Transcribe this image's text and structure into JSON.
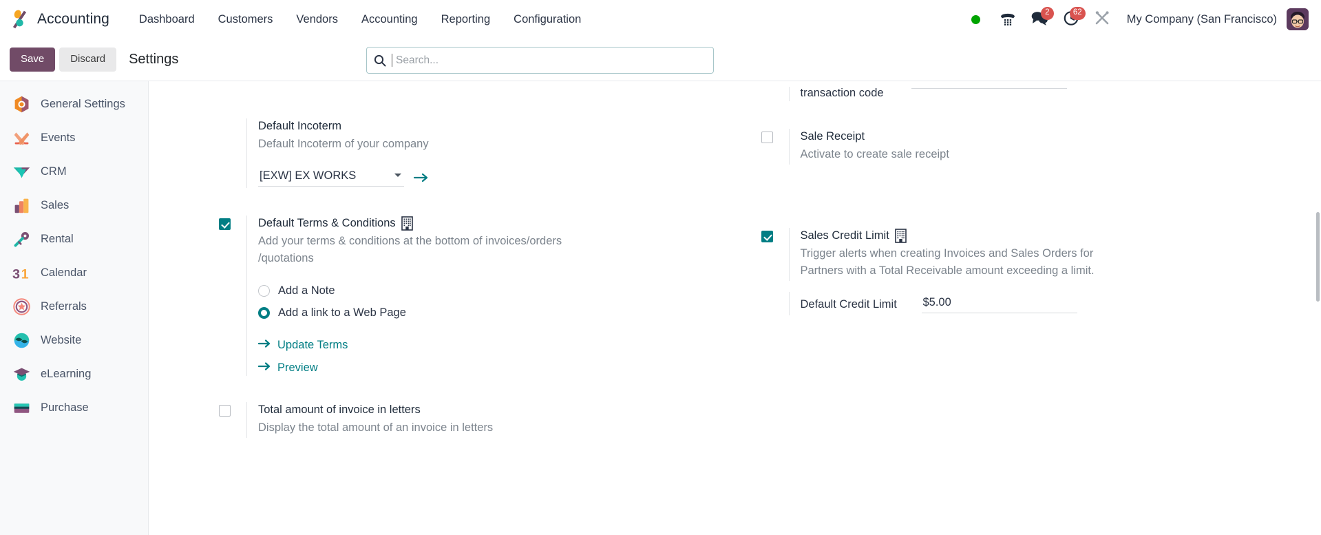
{
  "navbar": {
    "brand": "Accounting",
    "menu": [
      "Dashboard",
      "Customers",
      "Vendors",
      "Accounting",
      "Reporting",
      "Configuration"
    ],
    "status_indicator": "online",
    "messages_badge": "2",
    "activities_badge": "62",
    "company": "My Company (San Francisco)",
    "accent_color": "#714b67",
    "badge_color": "#d9534f",
    "status_color": "#00a400"
  },
  "control_panel": {
    "save_label": "Save",
    "discard_label": "Discard",
    "page_title": "Settings",
    "search_placeholder": "Search...",
    "search_value": ""
  },
  "sidebar": {
    "items": [
      {
        "label": "General Settings",
        "icon": "general-settings-icon"
      },
      {
        "label": "Events",
        "icon": "events-icon"
      },
      {
        "label": "CRM",
        "icon": "crm-icon"
      },
      {
        "label": "Sales",
        "icon": "sales-icon"
      },
      {
        "label": "Rental",
        "icon": "rental-icon"
      },
      {
        "label": "Calendar",
        "icon": "calendar-icon"
      },
      {
        "label": "Referrals",
        "icon": "referrals-icon"
      },
      {
        "label": "Website",
        "icon": "website-icon"
      },
      {
        "label": "eLearning",
        "icon": "elearning-icon"
      },
      {
        "label": "Purchase",
        "icon": "purchase-icon"
      }
    ]
  },
  "settings": {
    "partial_top": {
      "label": "transaction code"
    },
    "default_incoterm": {
      "title": "Default Incoterm",
      "description": "Default Incoterm of your company",
      "selected": "[EXW] EX WORKS",
      "options": [
        "[EXW] EX WORKS"
      ]
    },
    "sale_receipt": {
      "title": "Sale Receipt",
      "description": "Activate to create sale receipt",
      "checked": false
    },
    "default_terms": {
      "title": "Default Terms & Conditions",
      "description": "Add your terms & conditions at the bottom of invoices/orders /quotations",
      "checked": true,
      "company_scoped": true,
      "radio_note": "Add a Note",
      "radio_webpage": "Add a link to a Web Page",
      "selected_radio": "Add a link to a Web Page",
      "link_update": "Update Terms",
      "link_preview": "Preview"
    },
    "sales_credit_limit": {
      "title": "Sales Credit Limit",
      "description": "Trigger alerts when creating Invoices and Sales Orders for Partners with a Total Receivable amount exceeding a limit.",
      "checked": true,
      "company_scoped": true,
      "field_label": "Default Credit Limit",
      "field_value": "$5.00"
    },
    "total_in_letters": {
      "title": "Total amount of invoice in letters",
      "description": "Display the total amount of an invoice in letters",
      "checked": false
    }
  },
  "theme": {
    "teal": "#017e84",
    "purple": "#714b67"
  }
}
